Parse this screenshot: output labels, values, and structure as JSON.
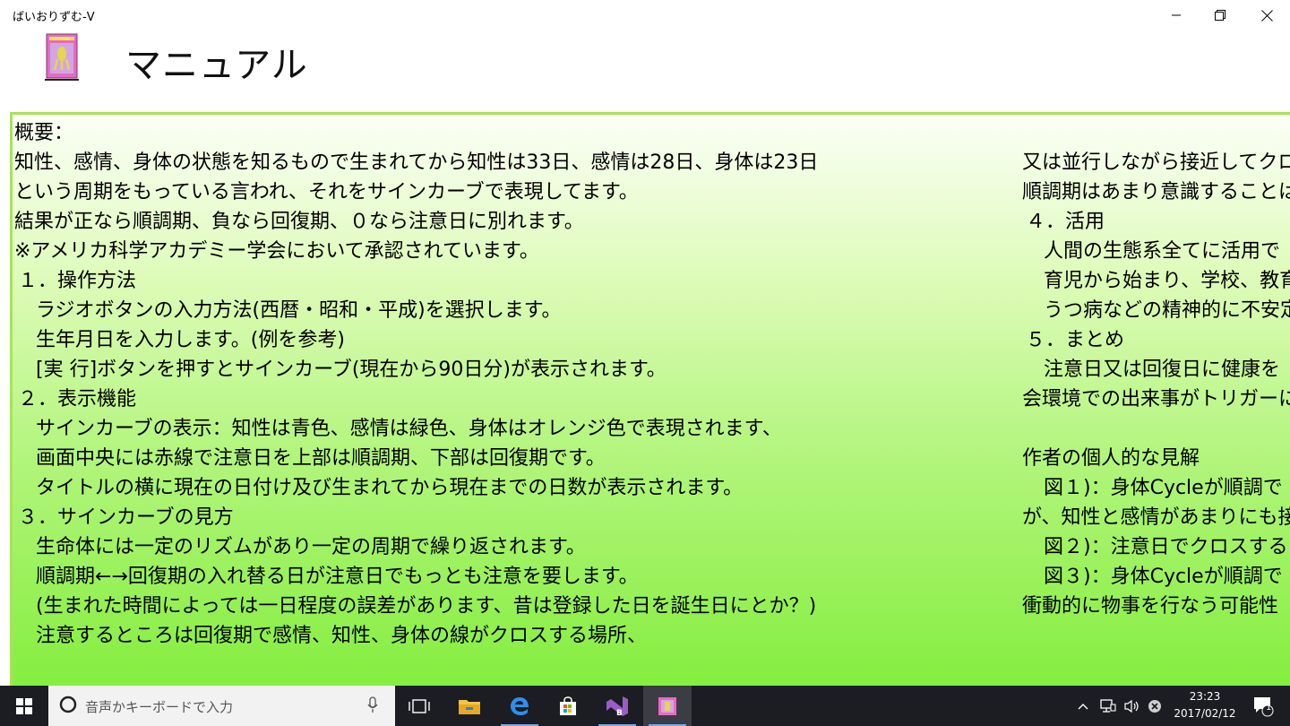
{
  "window": {
    "title": "ばいおりずむ-V",
    "controls": {
      "minimize": "minimize",
      "maximize": "restore",
      "close": "close"
    }
  },
  "header": {
    "title": "マニュアル",
    "icon": "biorhythm-book-icon"
  },
  "manual": {
    "col1": [
      "概要：",
      "知性、感情、身体の状態を知るもので生まれてから知性は33日、感情は28日、身体は23日",
      "という周期をもっている言われ、それをサインカーブで表現してます。",
      "結果が正なら順調期、負なら回復期、０なら注意日に別れます。",
      "※アメリカ科学アカデミー学会において承認されています。",
      "１．操作方法",
      "ラジオボタンの入力方法(西暦・昭和・平成)を選択します。",
      "生年月日を入力します。(例を参考)",
      "[実 行]ボタンを押すとサインカーブ(現在から90日分)が表示されます。",
      "２．表示機能",
      "サインカーブの表示：知性は青色、感情は緑色、身体はオレンジ色で表現されます、",
      "画面中央には赤線で注意日を上部は順調期、下部は回復期です。",
      "タイトルの横に現在の日付け及び生まれてから現在までの日数が表示されます。",
      "３．サインカーブの見方",
      "生命体には一定のリズムがあり一定の周期で繰り返されます。",
      "順調期←→回復期の入れ替る日が注意日でもっとも注意を要します。",
      "(生まれた時間によっては一日程度の誤差があります、昔は登録した日を誕生日にとか？)",
      "注意するところは回復期で感情、知性、身体の線がクロスする場所、"
    ],
    "col2": [
      "又は並行しながら接近してクロ",
      "順調期はあまり意識することは",
      "４．活用",
      "人間の生態系全てに活用で",
      "育児から始まり、学校、教育",
      "うつ病などの精神的に不安定",
      "５．まとめ",
      "注意日又は回復日に健康を",
      "会環境での出来事がトリガーに",
      "",
      "作者の個人的な見解",
      "図１)：身体Cycleが順調で",
      "が、知性と感情があまりにも接",
      "図２)：注意日でクロスする",
      "図３)：身体Cycleが順調で",
      "衝動的に物事を行なう可能性"
    ]
  },
  "taskbar": {
    "search_placeholder": "音声かキーボードで入力",
    "apps": [
      "task-view",
      "file-explorer",
      "edge",
      "store",
      "visual-studio-blend",
      "biorhythm-app"
    ],
    "clock": {
      "time": "23:23",
      "date": "2017/02/12"
    },
    "notification_count": "1",
    "colors": {
      "accent": "#76a9ea",
      "panel_top": "#fbfff6",
      "panel_bottom": "#85ee3f",
      "border": "#a8e25a"
    }
  }
}
